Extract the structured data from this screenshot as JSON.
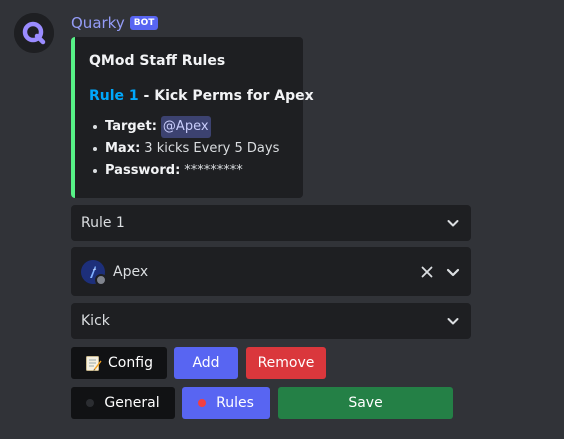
{
  "message": {
    "username": "Quarky",
    "bot_tag": "BOT",
    "avatar_icon": "quarky-q-logo",
    "accent_color": "#57f287"
  },
  "embed": {
    "title": "QMod Staff Rules",
    "rule_link": "Rule 1",
    "rule_desc": " - Kick Perms for Apex",
    "fields": [
      {
        "key": "Target:",
        "value": "@Apex"
      },
      {
        "key": "Max:",
        "value": "3 kicks Every 5 Days"
      },
      {
        "key": "Password:",
        "value": "*********"
      }
    ]
  },
  "selects": {
    "rule": {
      "value": "Rule 1"
    },
    "user": {
      "value": "Apex"
    },
    "action": {
      "value": "Kick"
    }
  },
  "buttons": {
    "config": {
      "label": "Config",
      "icon": "memo-icon"
    },
    "add": {
      "label": "Add"
    },
    "remove": {
      "label": "Remove"
    },
    "general": {
      "label": "General",
      "dot_color": "#1e1f22"
    },
    "rules": {
      "label": "Rules",
      "dot_color": "#f23f43"
    },
    "save": {
      "label": "Save"
    }
  }
}
